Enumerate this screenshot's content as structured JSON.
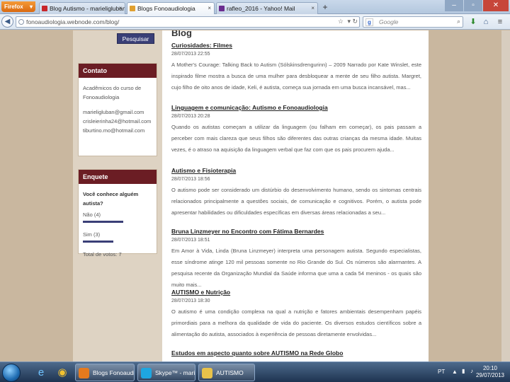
{
  "browser": {
    "menu_label": "Firefox",
    "tabs": [
      {
        "title": "Blog Autismo - marieligluban@gmai...",
        "fav_color": "#c8262b",
        "active": false
      },
      {
        "title": "Blogs Fonoaudiologia",
        "fav_color": "#e0a030",
        "active": true
      },
      {
        "title": "rafleo_2016 - Yahoo! Mail",
        "fav_color": "#6a2c8f",
        "active": false
      }
    ],
    "new_tab_label": "+",
    "url": "fonoaudiologia.webnode.com/blog/",
    "search_placeholder": "Google",
    "search_engine_letter": "g"
  },
  "sidebar": {
    "search_button": "Pesquisar",
    "contact": {
      "title": "Contato",
      "lines": [
        "Acadêmicos do curso de",
        "Fonoaudiologia",
        "marieligluban@gmail.com",
        "crisleierinha24@hotmail.com",
        "tiburtino.mo@hotmail.com"
      ]
    },
    "poll": {
      "title": "Enquete",
      "question": "Você conhece alguém autista?",
      "options": [
        {
          "label": "Não (4)",
          "share": 0.57
        },
        {
          "label": "Sim (3)",
          "share": 0.43
        }
      ],
      "total": "Total de votos: 7"
    }
  },
  "blog": {
    "title": "Blog",
    "posts": [
      {
        "title": "Curiosidades: Filmes",
        "date": "28/07/2013 22:55",
        "text": "A Mother's Courage: Talking Back to Autism (Sólskinsdrengurinn) – 2009 Narrado por Kate Winslet, este inspirado filme mostra a busca de uma mulher para desbloquear a mente de seu filho autista. Margret, cujo filho de oito anos de idade, Keli, é autista, começa sua jornada em uma busca incansável, mas..."
      },
      {
        "title": "Linguagem e comunicação: Autismo e Fonoaudiologia",
        "date": "28/07/2013 20:28",
        "text": "Quando os autistas começam a utilizar da linguagem (ou falham em começar), os pais passam a perceber com mais clareza que seus filhos são diferentes das outras crianças da mesma idade. Muitas vezes, é o atraso na aquisição da linguagem verbal que faz com que os pais procurem ajuda..."
      },
      {
        "title": "Autismo e Fisioterapia",
        "date": "28/07/2013 18:56",
        "text": "O autismo pode ser considerado um distúrbio do desenvolvimento humano, sendo os sintomas centrais relacionados principalmente a questões sociais, de comunicação e cognitivos. Porém, o autista pode apresentar habilidades ou dificuldades específicas em diversas áreas relacionadas a seu..."
      },
      {
        "title": "Bruna Linzmeyer no Encontro com Fátima Bernardes",
        "date": "28/07/2013 18:51",
        "text": "Em Amor à Vida, Linda (Bruna Linzmeyer) interpreta uma personagem autista. Segundo especialistas, esse síndrome atinge 120 mil pessoas somente no Rio Grande do Sul. Os números são alarmantes. A pesquisa recente da Organização Mundial da Saúde informa que uma a cada 54 meninos - os quais são muito mais..."
      },
      {
        "title": "AUTISMO e Nutrição",
        "date": "28/07/2013 18:30",
        "text": "O autismo é uma condição complexa na qual a nutrição e fatores ambientais desempenham papéis primordiais para a melhora da qualidade de vida do paciente. Os diversos estudos científicos sobre a alimentação do autista, associados à experiência de pessoas diretamente envolvidas..."
      },
      {
        "title": "Estudos em aspecto quanto sobre AUTISMO na Rede Globo",
        "date": "",
        "text": ""
      }
    ]
  },
  "taskbar": {
    "items": [
      {
        "label": "Blogs Fonoaudio...",
        "icon_color": "#e57a1e"
      },
      {
        "label": "Skype™ - marielig...",
        "icon_color": "#1ea6e0"
      },
      {
        "label": "AUTISMO",
        "icon_color": "#e8c24a"
      }
    ],
    "lang": "PT",
    "time": "20:10",
    "date": "29/07/2013"
  },
  "colors": {
    "page_bg": "#c9b79f",
    "panel_header": "#6b1d24",
    "button": "#3a3f77"
  }
}
